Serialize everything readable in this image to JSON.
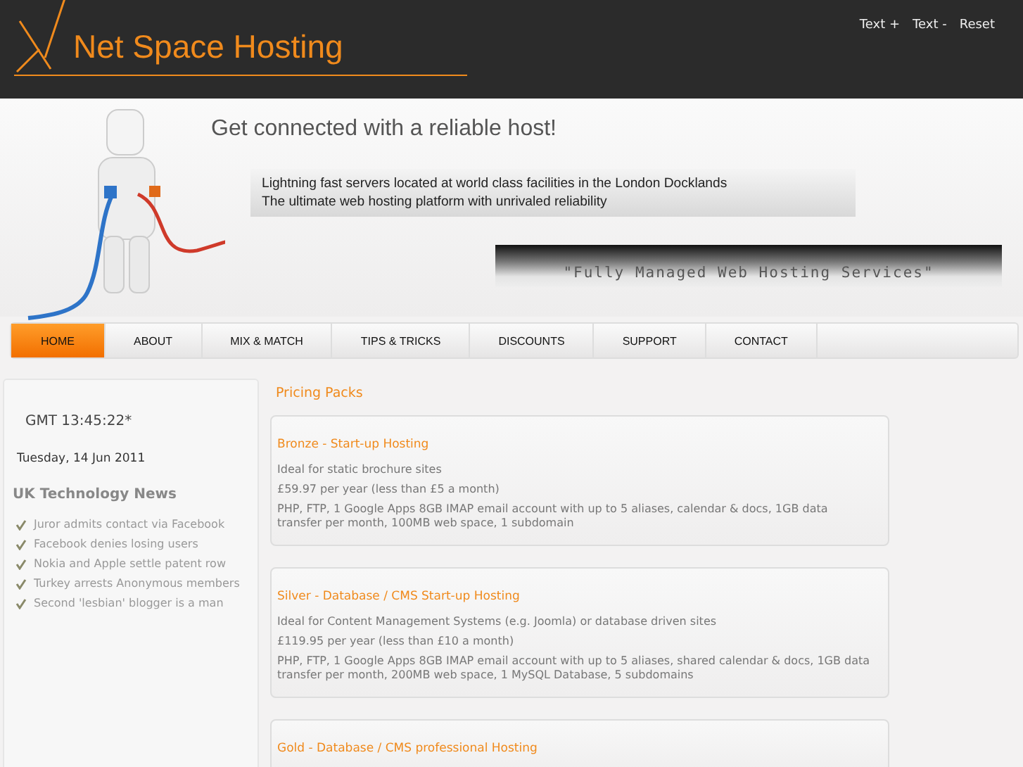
{
  "header": {
    "logo": "Net Space Hosting",
    "text_controls": [
      "Text +",
      "Text -",
      "Reset"
    ]
  },
  "banner": {
    "headline": "Get connected with a reliable host!",
    "lines": [
      "Lightning fast servers located at world class facilities in the London Docklands",
      "The ultimate web hosting platform with unrivaled reliability"
    ],
    "tagline": "\"Fully Managed Web Hosting Services\""
  },
  "nav": [
    {
      "label": "HOME",
      "selected": true
    },
    {
      "label": "ABOUT",
      "selected": false
    },
    {
      "label": "MIX & MATCH",
      "selected": false
    },
    {
      "label": "TIPS & TRICKS",
      "selected": false
    },
    {
      "label": "DISCOUNTS",
      "selected": false
    },
    {
      "label": "SUPPORT",
      "selected": false
    },
    {
      "label": "CONTACT",
      "selected": false
    }
  ],
  "sidebar": {
    "clock": "GMT 13:45:22*",
    "date": "Tuesday, 14 Jun 2011",
    "news_title": "UK Technology News",
    "news": [
      "Juror admits contact via Facebook",
      "Facebook denies losing users",
      "Nokia and Apple settle patent row",
      "Turkey arrests Anonymous members",
      "Second 'lesbian' blogger is a man"
    ]
  },
  "pricing": {
    "title": "Pricing Packs",
    "packs": [
      {
        "name": "Bronze - Start-up Hosting",
        "lines": [
          "Ideal for static brochure sites",
          "£59.97 per year (less than £5 a month)",
          "PHP, FTP, 1 Google Apps 8GB IMAP email account with up to 5 aliases, calendar & docs, 1GB data transfer per month, 100MB web space, 1 subdomain"
        ]
      },
      {
        "name": "Silver - Database / CMS Start-up Hosting",
        "lines": [
          "Ideal for Content Management Systems (e.g. Joomla) or database driven sites",
          "£119.95 per year (less than £10 a month)",
          "PHP, FTP, 1 Google Apps 8GB IMAP email account with up to 5 aliases, shared calendar & docs, 1GB data transfer per month, 200MB web space, 1 MySQL Database, 5 subdomains"
        ]
      },
      {
        "name": "Gold - Database / CMS professional Hosting"
      }
    ]
  }
}
